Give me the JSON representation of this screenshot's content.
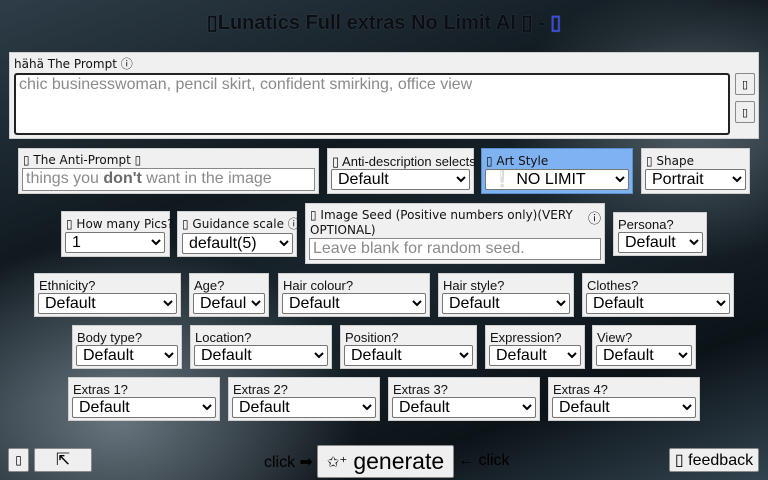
{
  "header": {
    "title": "▯Lunatics Full extras No Limit AI ▯ -",
    "link": "▯"
  },
  "prompt": {
    "label": "hähä The Prompt ⓘ",
    "placeholder": "chic businesswoman, pencil skirt, confident smirking, office view",
    "side_btn_1": "▯",
    "side_btn_2": "▯"
  },
  "anti_prompt": {
    "label": "▯ The Anti-Prompt ▯",
    "placeholder_pre": "things you ",
    "placeholder_bold": "don't",
    "placeholder_post": " want in the image"
  },
  "anti_desc": {
    "label": "▯ Anti-description selects",
    "value": "Default"
  },
  "art_style": {
    "label": "▯ Art Style",
    "value": "❕ NO LIMIT"
  },
  "shape": {
    "label": "▯ Shape",
    "value": "Portrait"
  },
  "pics": {
    "label": "▯ How many Pics?",
    "value": "1"
  },
  "guidance": {
    "label": "▯ Guidance scale ⓘ",
    "value": "default(5)"
  },
  "seed": {
    "label": "▯ Image Seed (Positive numbers only)(VERY OPTIONAL)",
    "info": "ⓘ",
    "placeholder": "Leave blank for random seed."
  },
  "persona": {
    "label": "Persona?",
    "value": "Default"
  },
  "row3": [
    {
      "label": "Ethnicity?",
      "value": "Default"
    },
    {
      "label": "Age?",
      "value": "Default"
    },
    {
      "label": "Hair colour?",
      "value": "Default"
    },
    {
      "label": "Hair style?",
      "value": "Default"
    },
    {
      "label": "Clothes?",
      "value": "Default"
    }
  ],
  "row4": [
    {
      "label": "Body type?",
      "value": "Default"
    },
    {
      "label": "Location?",
      "value": "Default"
    },
    {
      "label": "Position?",
      "value": "Default"
    },
    {
      "label": "Expression?",
      "value": "Default"
    },
    {
      "label": "View?",
      "value": "Default"
    }
  ],
  "row5": [
    {
      "label": "Extras 1?",
      "value": "Default"
    },
    {
      "label": "Extras 2?",
      "value": "Default"
    },
    {
      "label": "Extras 3?",
      "value": "Default"
    },
    {
      "label": "Extras 4?",
      "value": "Default"
    }
  ],
  "footer": {
    "small_btn": "▯",
    "expand_icon": "⇱",
    "click_left": "click ➡",
    "generate_icon": "✩⁺",
    "generate_label": "generate",
    "click_right": "← click",
    "feedback": "▯ feedback"
  },
  "colors": {
    "panel": "#f0f0f0",
    "art_style_highlight": "#7fb2f0",
    "link": "#3a4bd8"
  }
}
